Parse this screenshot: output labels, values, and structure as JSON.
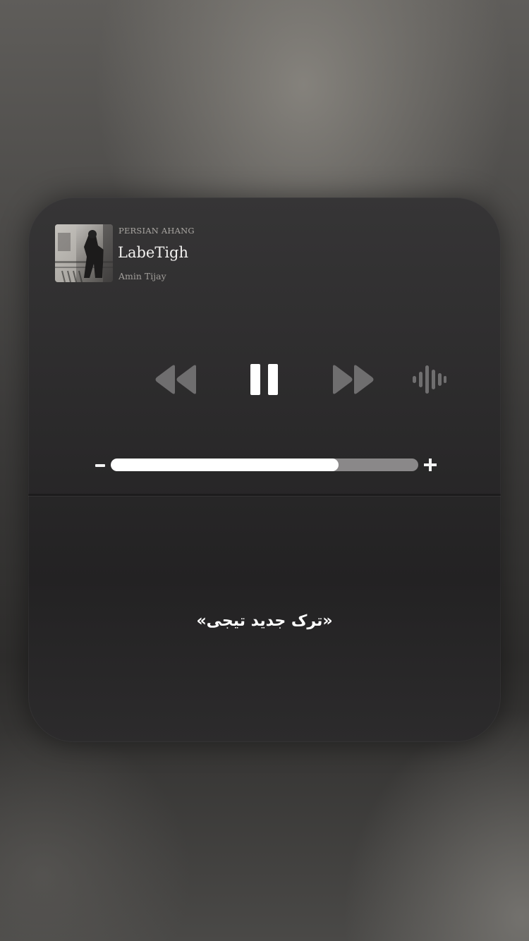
{
  "player": {
    "source": "PERSIAN AHANG",
    "title": "LabeTigh",
    "artist": "Amin Tijay",
    "album_art": "album-art-photo",
    "state": "playing",
    "controls": {
      "rewind_icon": "rewind-icon",
      "pause_icon": "pause-icon",
      "forward_icon": "fast-forward-icon",
      "audio_icon": "audio-waveform-icon"
    },
    "volume": {
      "level": 0.74,
      "minus_icon": "volume-minus-icon",
      "plus_icon": "volume-plus-icon"
    },
    "colors": {
      "controls": "#6f6e6f",
      "active": "#ffffff",
      "track": "#8a8889"
    }
  },
  "caption": "«ترک جدید تیجی»"
}
